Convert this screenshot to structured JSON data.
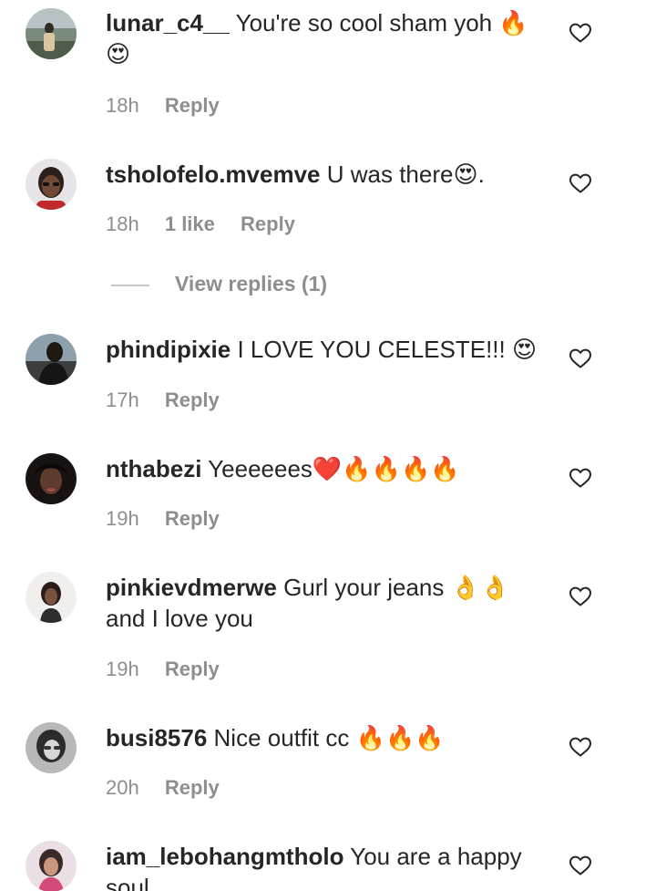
{
  "comments": [
    {
      "username": "lunar_c4__",
      "text": "You're so cool sham yoh 🔥 😍",
      "time": "18h",
      "likes": "",
      "reply": "Reply"
    },
    {
      "username": "tsholofelo.mvemve",
      "text": "U was there😍.",
      "time": "18h",
      "likes": "1 like",
      "reply": "Reply"
    },
    {
      "username": "phindipixie",
      "text": "I LOVE YOU CELESTE!!! 😍",
      "time": "17h",
      "likes": "",
      "reply": "Reply"
    },
    {
      "username": "nthabezi",
      "text": "Yeeeeees❤️🔥🔥🔥🔥",
      "time": "19h",
      "likes": "",
      "reply": "Reply"
    },
    {
      "username": "pinkievdmerwe",
      "text": "Gurl your jeans 👌👌 and I love you",
      "time": "19h",
      "likes": "",
      "reply": "Reply"
    },
    {
      "username": "busi8576",
      "text": "Nice outfit cc 🔥🔥🔥",
      "time": "20h",
      "likes": "",
      "reply": "Reply"
    },
    {
      "username": "iam_lebohangmtholo",
      "text": "You are a happy soul",
      "time": "",
      "likes": "",
      "reply": ""
    }
  ],
  "view_replies": "View replies (1)",
  "icons": {
    "like": "heart-outline-icon"
  },
  "colors": {
    "text": "#262626",
    "muted": "#8e8e8e",
    "background": "#ffffff"
  }
}
